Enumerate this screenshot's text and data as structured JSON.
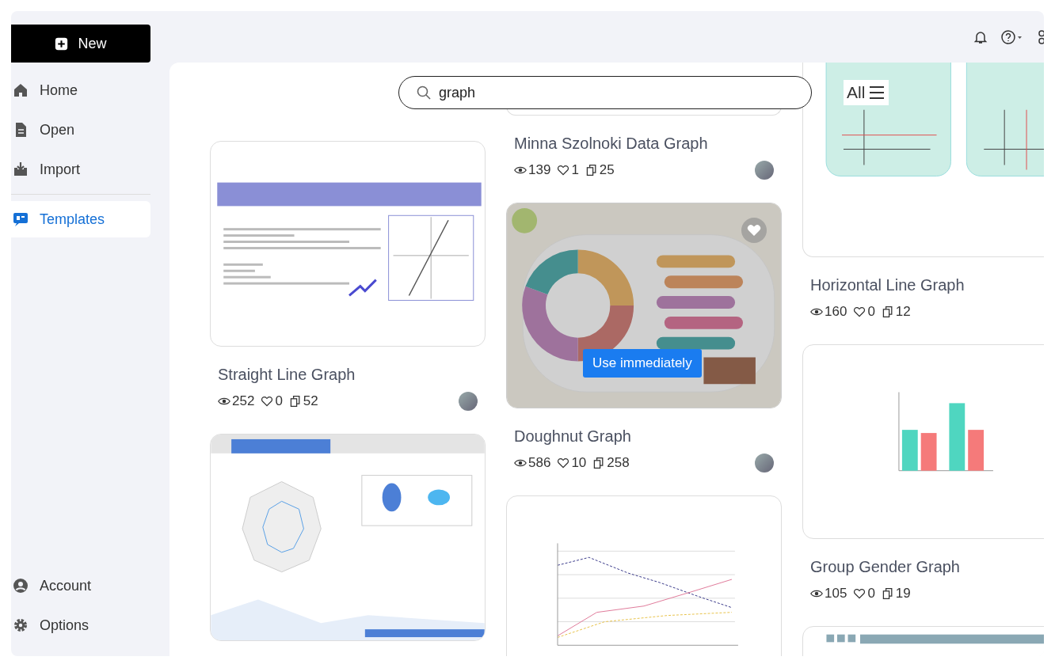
{
  "sidebar": {
    "new_button": "New",
    "items": [
      {
        "label": "Home",
        "selected": false
      },
      {
        "label": "Open",
        "selected": false
      },
      {
        "label": "Import",
        "selected": false
      },
      {
        "label": "Templates",
        "selected": true
      }
    ],
    "bottom_items": [
      {
        "label": "Account"
      },
      {
        "label": "Options"
      }
    ]
  },
  "search": {
    "value": "graph"
  },
  "filter": {
    "label": "All"
  },
  "columns": [
    {
      "cards": [
        {
          "kind": "line-graph",
          "hovered": false,
          "title": "Straight Line Graph",
          "views": "252",
          "likes": "0",
          "copies": "52"
        },
        {
          "kind": "spider",
          "hovered": false
        }
      ]
    },
    {
      "cards": [
        {
          "kind": "blank",
          "hovered": false,
          "title": "Minna Szolnoki Data Graph",
          "views": "139",
          "likes": "1",
          "copies": "25"
        },
        {
          "kind": "donut",
          "hovered": true,
          "action": "Use immediately",
          "title": "Doughnut Graph",
          "views": "586",
          "likes": "10",
          "copies": "258"
        },
        {
          "kind": "multi-line",
          "hovered": false
        }
      ]
    },
    {
      "cards": [
        {
          "kind": "axes",
          "hovered": false,
          "title": "Horizontal Line Graph",
          "views": "160",
          "likes": "0",
          "copies": "12"
        },
        {
          "kind": "bar",
          "hovered": false,
          "title": "Group Gender Graph",
          "views": "105",
          "likes": "0",
          "copies": "19"
        },
        {
          "kind": "column",
          "hovered": false
        }
      ]
    }
  ]
}
